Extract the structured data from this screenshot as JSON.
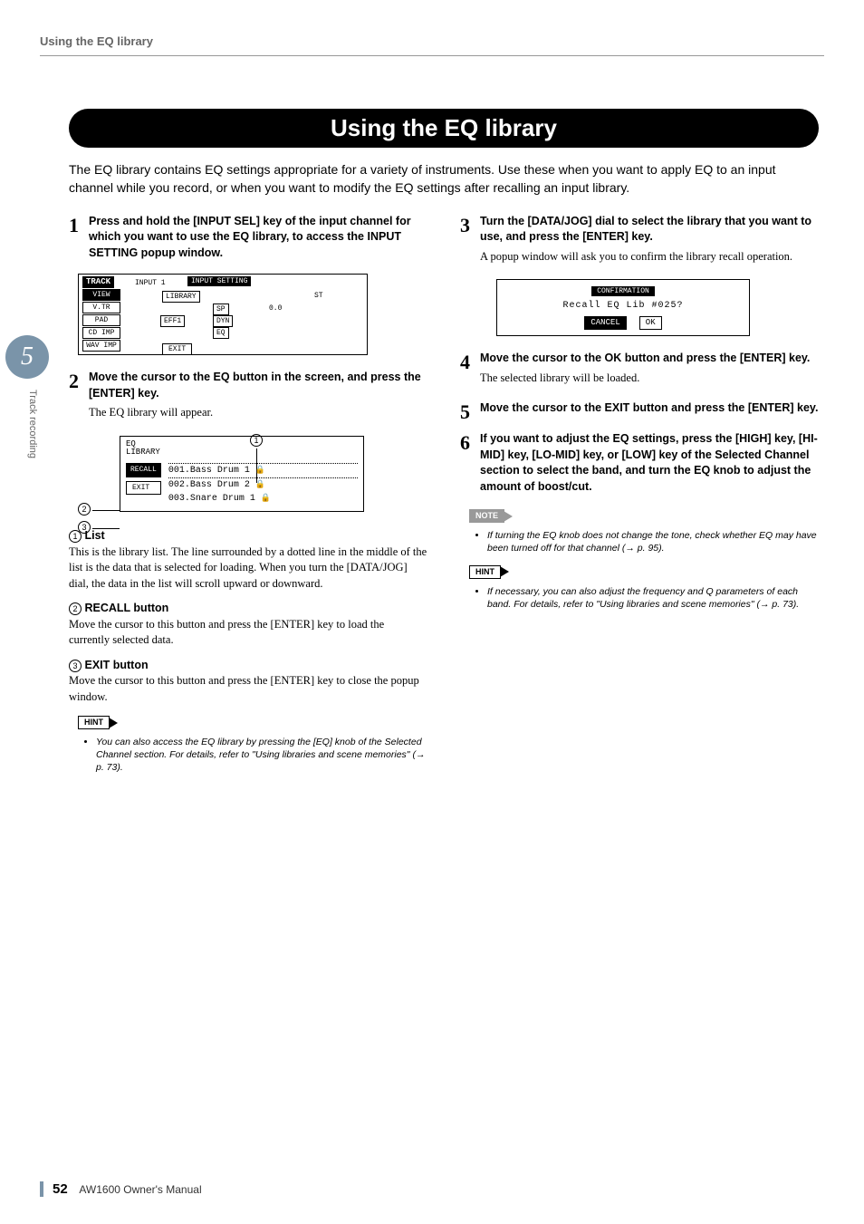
{
  "header": {
    "section": "Using the EQ library"
  },
  "side": {
    "chapter_num": "5",
    "chapter_label": "Track recording"
  },
  "title": "Using the EQ library",
  "intro": "The EQ library contains EQ settings appropriate for a variety of instruments. Use these when you want to apply EQ to an input channel while you record, or when you want to modify the EQ settings after recalling an input library.",
  "left": {
    "step1": {
      "num": "1",
      "head": "Press and hold the [INPUT SEL] key of the input channel for which you want to use the EQ library, to access the INPUT SETTING popup window."
    },
    "step2": {
      "num": "2",
      "head": "Move the cursor to the EQ button in the screen, and press the [ENTER] key.",
      "text": "The EQ library will appear."
    },
    "shot1": {
      "track": "TRACK",
      "input": "INPUT  1",
      "setting": "INPUT SETTING",
      "view": "VIEW",
      "vtr": "V.TR",
      "pad": "PAD",
      "cd": "CD  IMP",
      "wav": "WAV IMP",
      "library": "LIBRARY",
      "eff": "EFF1",
      "sp": "SP",
      "dyn": "DYN",
      "eq": "EQ",
      "exit": "EXIT",
      "zero": "0.0",
      "st": "ST"
    },
    "shot2": {
      "eq": "EQ",
      "lib": "LIBRARY",
      "recall": "RECALL",
      "exit": "EXIT",
      "l1": "001.Bass Drum 1",
      "l2": "002.Bass Drum 2",
      "l3": "003.Snare Drum 1"
    },
    "defs": {
      "d1_label": "List",
      "d1_text": "This is the library list. The line surrounded by a dotted line in the middle of the list is the data that is selected for loading. When you turn the [DATA/JOG] dial, the data in the list will scroll upward or downward.",
      "d2_label": "RECALL button",
      "d2_text": "Move the cursor to this button and press the [ENTER] key to load the currently selected data.",
      "d3_label": "EXIT button",
      "d3_text": "Move the cursor to this button and press the [ENTER] key to close the popup window."
    },
    "hint": {
      "tag": "HINT",
      "text": "You can also access the EQ library by pressing the [EQ] knob of the Selected Channel section. For details, refer to \"Using libraries and scene memories\" (→ p. 73)."
    }
  },
  "right": {
    "step3": {
      "num": "3",
      "head": "Turn the [DATA/JOG] dial to select the library that you want to use, and press the [ENTER] key.",
      "text": "A popup window will ask you to confirm the library recall operation."
    },
    "shot3": {
      "conf": "CONFIRMATION",
      "line": "Recall   EQ    Lib #025?",
      "cancel": "CANCEL",
      "ok": "OK"
    },
    "step4": {
      "num": "4",
      "head": "Move the cursor to the OK button and press the [ENTER] key.",
      "text": "The selected library will be loaded."
    },
    "step5": {
      "num": "5",
      "head": "Move the cursor to the EXIT button and press the [ENTER] key."
    },
    "step6": {
      "num": "6",
      "head": "If you want to adjust the EQ settings, press the [HIGH] key, [HI-MID] key, [LO-MID] key, or [LOW] key of the Selected Channel section to select the band, and turn the EQ knob to adjust the amount of boost/cut."
    },
    "note": {
      "tag": "NOTE",
      "text": "If turning the EQ knob does not change the tone, check whether EQ may have been turned off for that channel (→ p. 95)."
    },
    "hint": {
      "tag": "HINT",
      "text": "If necessary, you can also adjust the frequency and Q parameters of each band. For details, refer to \"Using libraries and scene memories\" (→ p. 73)."
    }
  },
  "footer": {
    "page": "52",
    "manual": "AW1600  Owner's Manual"
  }
}
